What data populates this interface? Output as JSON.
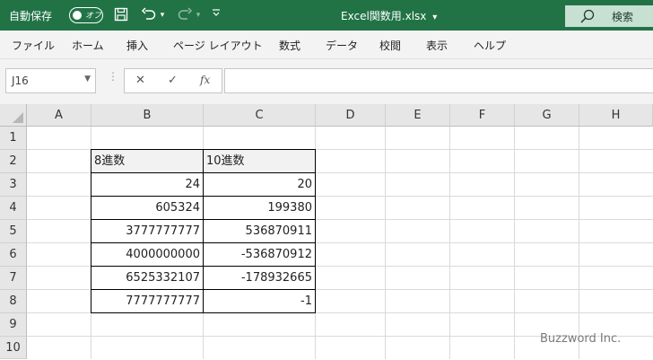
{
  "titlebar": {
    "autosave_label": "自動保存",
    "autosave_state": "オフ",
    "filename": "Excel関数用.xlsx",
    "filename_caret": "▾",
    "search_label": "検索",
    "accent": "#217346"
  },
  "ribbon": {
    "tabs": [
      "ファイル",
      "ホーム",
      "挿入",
      "ページ レイアウト",
      "数式",
      "データ",
      "校閲",
      "表示",
      "ヘルプ"
    ]
  },
  "formula_bar": {
    "name_box": "J16",
    "cancel": "✕",
    "enter": "✓",
    "fx": "fx",
    "content": ""
  },
  "sheet": {
    "columns": [
      "A",
      "B",
      "C",
      "D",
      "E",
      "F",
      "G",
      "H"
    ],
    "rows": [
      "1",
      "2",
      "3",
      "4",
      "5",
      "6",
      "7",
      "8",
      "9",
      "10"
    ],
    "table_header": [
      "8進数",
      "10進数"
    ],
    "table_rows": [
      [
        "24",
        "20"
      ],
      [
        "605324",
        "199380"
      ],
      [
        "3777777777",
        "536870911"
      ],
      [
        "4000000000",
        "-536870912"
      ],
      [
        "6525332107",
        "-178932665"
      ],
      [
        "7777777777",
        "-1"
      ]
    ]
  },
  "watermark": "Buzzword Inc."
}
